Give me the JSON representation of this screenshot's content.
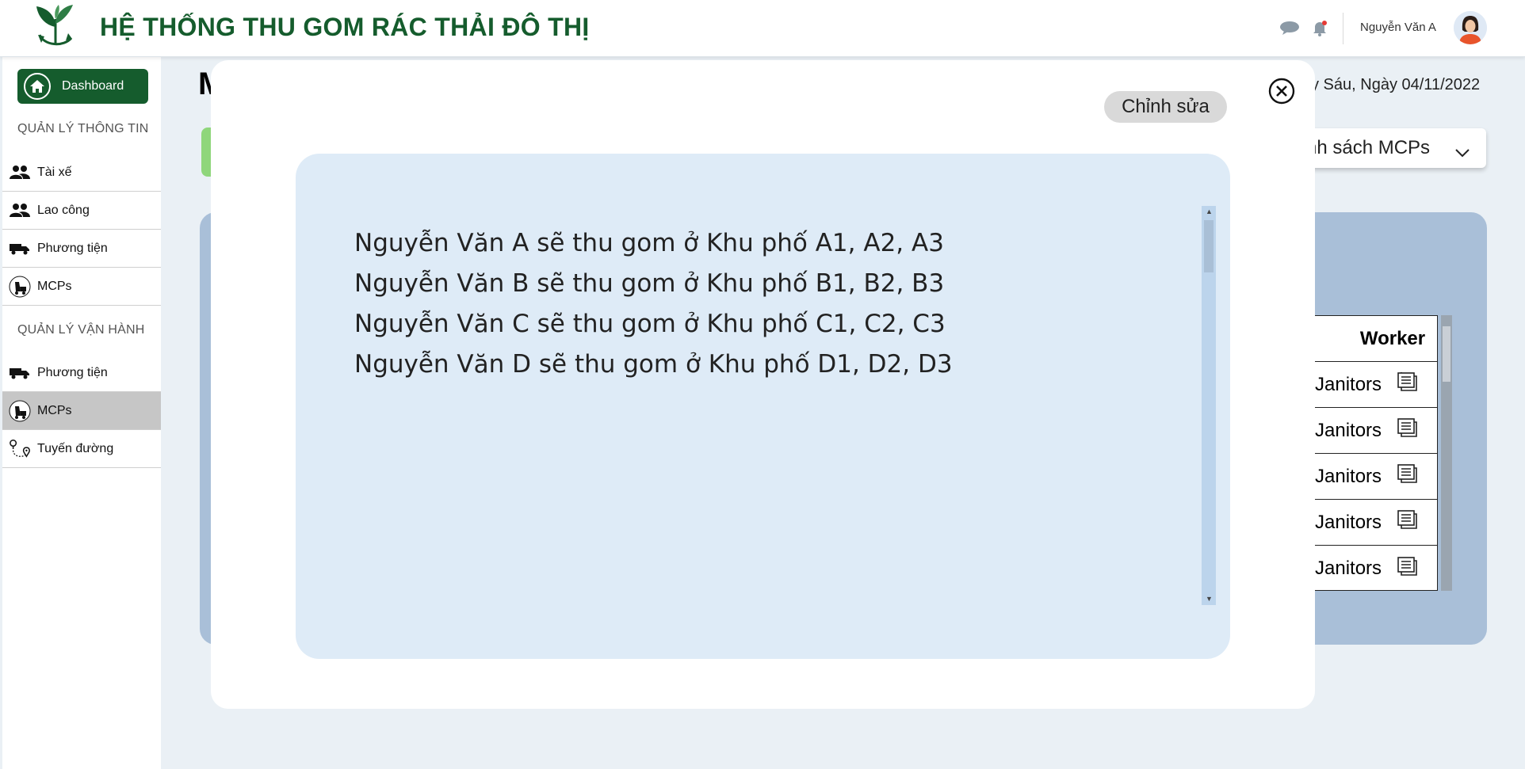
{
  "header": {
    "title": "HỆ THỐNG THU GOM RÁC THẢI ĐÔ THỊ",
    "user_name": "Nguyễn Văn A"
  },
  "sidebar": {
    "dashboard_label": "Dashboard",
    "section_info": "QUẢN LÝ THÔNG TIN",
    "info_items": [
      {
        "label": "Tài xế",
        "icon": "people-icon"
      },
      {
        "label": "Lao công",
        "icon": "people-icon"
      },
      {
        "label": "Phương tiện",
        "icon": "truck-icon"
      },
      {
        "label": "MCPs",
        "icon": "mcp-icon"
      }
    ],
    "section_ops": "QUẢN LÝ VẬN HÀNH",
    "ops_items": [
      {
        "label": "Phương tiện",
        "icon": "truck-icon"
      },
      {
        "label": "MCPs",
        "icon": "mcp-icon",
        "active": true
      },
      {
        "label": "Tuyến đường",
        "icon": "route-icon"
      }
    ]
  },
  "background": {
    "page_title_fragment": "M",
    "date_text": "y Sáu, Ngày 04/11/2022",
    "mcp_select": "nh sách MCPs",
    "worker_table": {
      "header": "Worker",
      "rows": [
        "Janitors",
        "Janitors",
        "Janitors",
        "Janitors",
        "Janitors"
      ]
    }
  },
  "modal": {
    "edit_label": "Chỉnh sửa",
    "lines": [
      "Nguyễn Văn A sẽ thu gom ở Khu phố A1, A2, A3",
      "Nguyễn Văn B sẽ thu gom ở Khu phố B1, B2, B3",
      "Nguyễn Văn C sẽ thu gom ở Khu phố C1, C2, C3",
      "Nguyễn Văn D sẽ thu gom ở Khu phố D1, D2, D3"
    ]
  },
  "colors": {
    "brand_green": "#155c2d",
    "background": "#eaf0f5",
    "panel": "#a9bfd8",
    "content_box": "#deebf7"
  }
}
